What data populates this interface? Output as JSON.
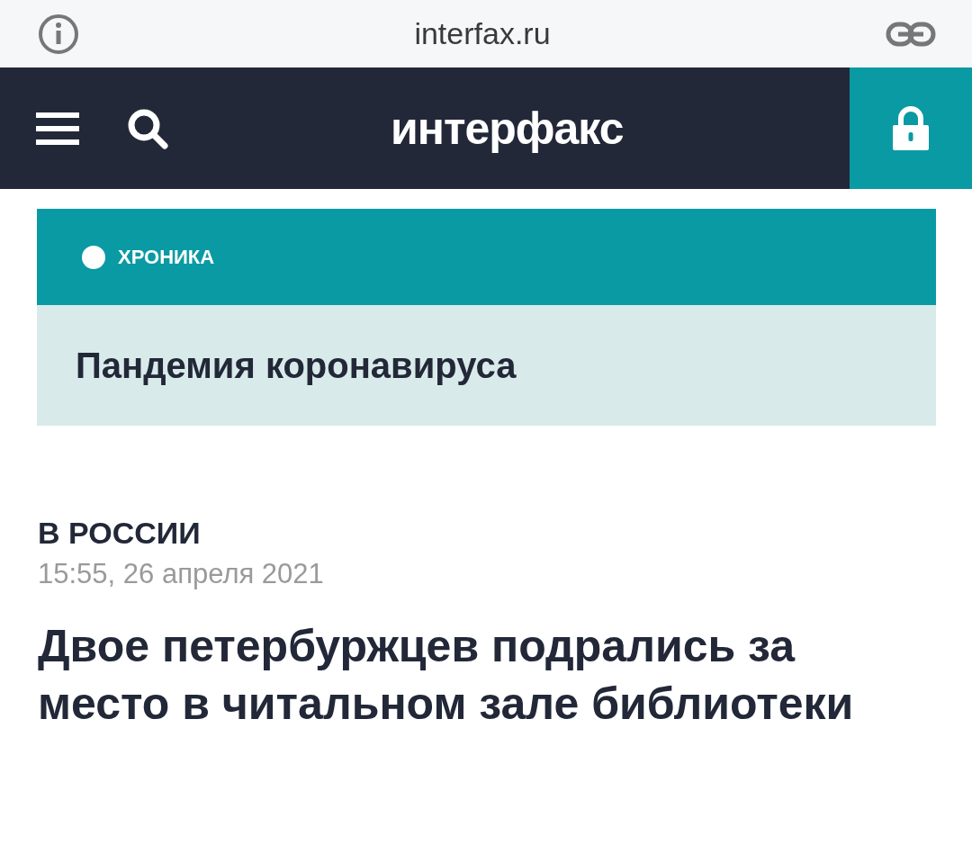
{
  "address_bar": {
    "url": "interfax.ru"
  },
  "header": {
    "logo": "интерфакс"
  },
  "chronicle": {
    "label": "ХРОНИКА",
    "title": "Пандемия коронавируса"
  },
  "article": {
    "section": "В РОССИИ",
    "date": "15:55, 26 апреля 2021",
    "headline": "Двое петербуржцев подрались за место в читальном зале библиотеки"
  }
}
